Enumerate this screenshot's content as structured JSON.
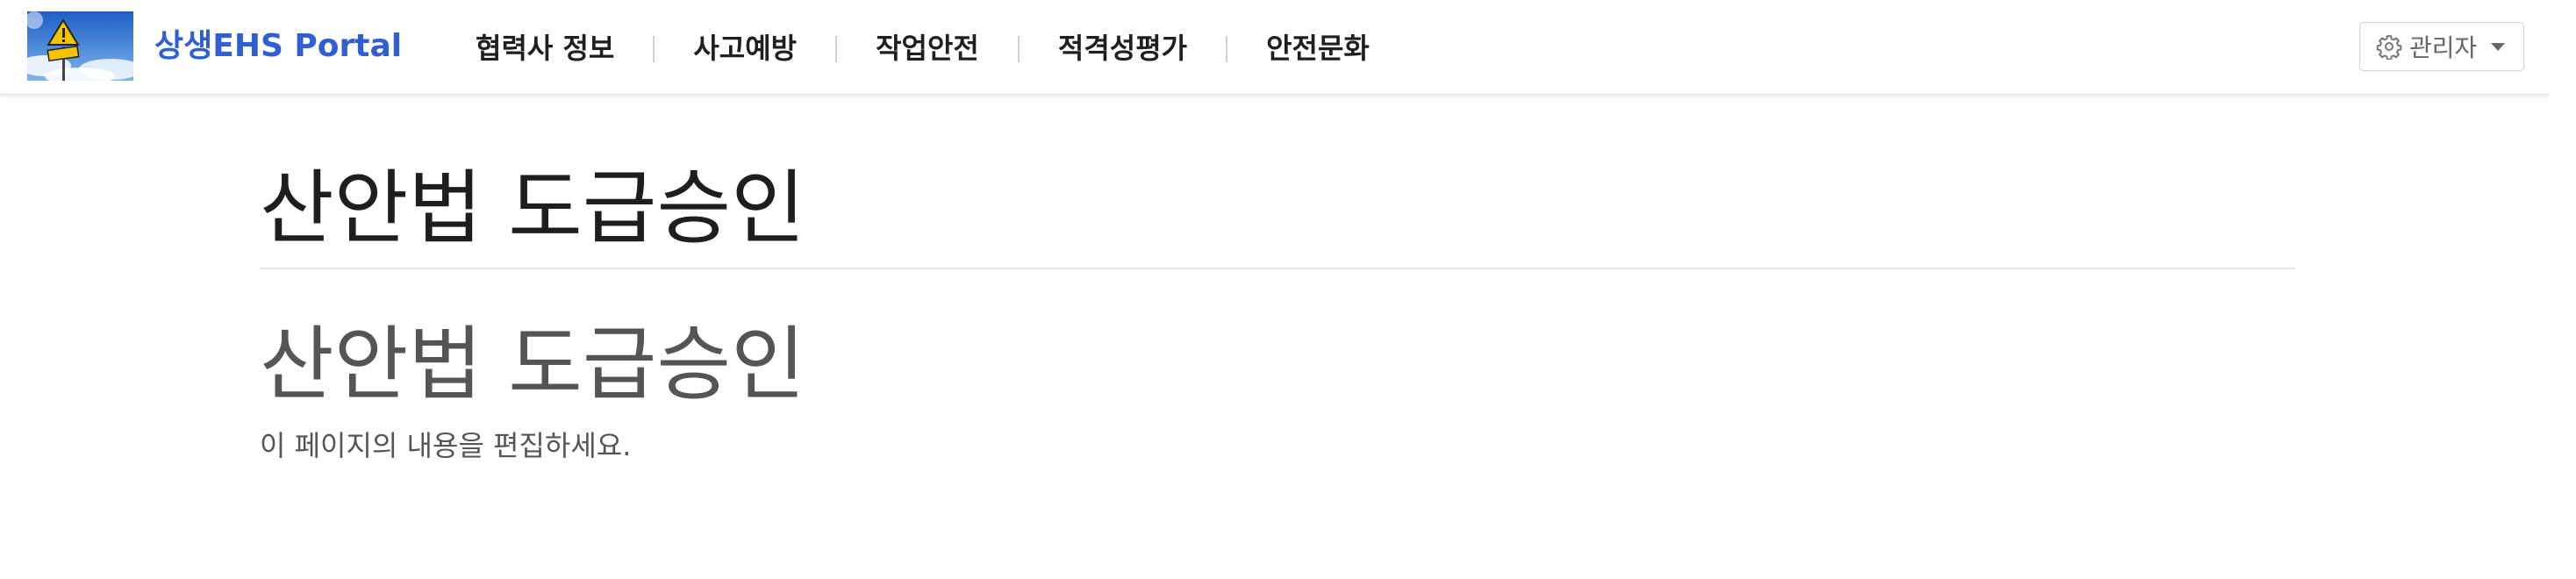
{
  "header": {
    "brand": "상생EHS Portal",
    "nav": [
      {
        "label": "협력사 정보"
      },
      {
        "label": "사고예방"
      },
      {
        "label": "작업안전"
      },
      {
        "label": "적격성평가"
      },
      {
        "label": "안전문화"
      }
    ],
    "admin_label": "관리자"
  },
  "icons": {
    "logo": "safety-warning-sign-icon",
    "admin": "gear-icon",
    "dropdown": "caret-down-icon"
  },
  "colors": {
    "brand": "#2f5fd0",
    "nav_text": "#1f1f1f",
    "page_title": "#1e1e1e",
    "body_text": "#555555"
  },
  "main": {
    "page_title": "산안법 도급승인",
    "content_heading": "산안법 도급승인",
    "content_text": "이 페이지의 내용을 편집하세요."
  }
}
